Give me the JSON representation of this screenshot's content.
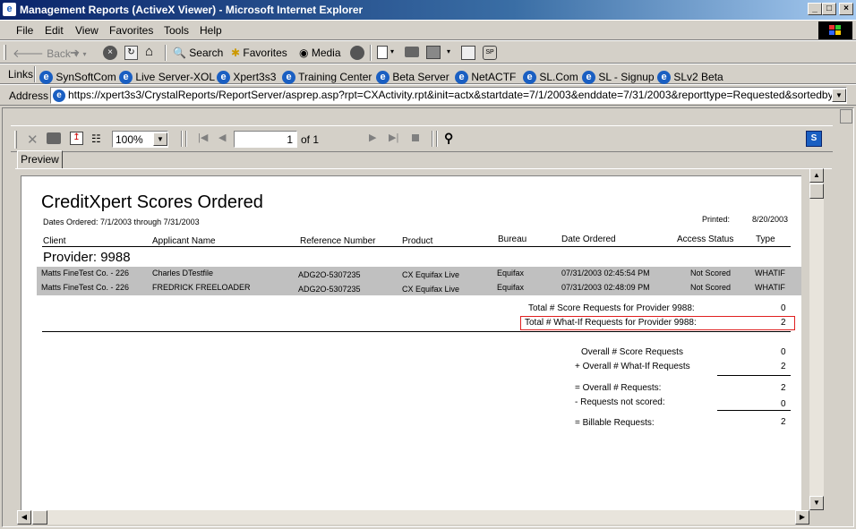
{
  "window": {
    "title": "Management Reports (ActiveX Viewer) - Microsoft Internet Explorer",
    "minimize": "_",
    "maximize": "□",
    "close": "×"
  },
  "menu": [
    "File",
    "Edit",
    "View",
    "Favorites",
    "Tools",
    "Help"
  ],
  "toolbar": {
    "back": "Back",
    "search": "Search",
    "favorites": "Favorites",
    "media": "Media"
  },
  "links": {
    "label": "Links",
    "items": [
      "SynSoftCom",
      "Live Server-XOL",
      "Xpert3s3",
      "Training Center",
      "Beta Server",
      "NetACTF",
      "SL.Com",
      "SL - Signup",
      "SLv2 Beta"
    ]
  },
  "address": {
    "label": "Address",
    "url": "https://xpert3s3/CrystalReports/ReportServer/asprep.asp?rpt=CXActivity.rpt&init=actx&startdate=7/1/2003&enddate=7/31/2003&reporttype=Requested&sortedby=Date"
  },
  "viewer": {
    "zoom": "100%",
    "page_value": "1",
    "page_of": "of 1",
    "tab": "Preview"
  },
  "report": {
    "title": "CreditXpert Scores Ordered",
    "dates": "Dates Ordered: 7/1/2003 through 7/31/2003",
    "printed_label": "Printed:",
    "printed_value": "8/20/2003",
    "columns": [
      "Client",
      "Applicant Name",
      "Reference Number",
      "Product",
      "Bureau",
      "Date Ordered",
      "Access Status",
      "Type"
    ],
    "provider": "Provider:  9988",
    "rows": [
      [
        "Matts FineTest Co. - 226",
        "Charles DTestfile",
        "ADG2O-5307235",
        "CX Equifax Live",
        "Equifax",
        "07/31/2003 02:45:54 PM",
        "Not Scored",
        "WHATIF"
      ],
      [
        "Matts FineTest Co. - 226",
        "FREDRICK FREELOADER",
        "ADG2O-5307235",
        "CX Equifax Live",
        "Equifax",
        "07/31/2003 02:48:09 PM",
        "Not Scored",
        "WHATIF"
      ]
    ],
    "provider_totals": [
      {
        "label": "Total # Score Requests for Provider 9988:",
        "value": "0"
      },
      {
        "label": "Total # What-If Requests for Provider 9988:",
        "value": "2"
      }
    ],
    "overall": [
      {
        "label": "Overall # Score Requests",
        "value": "0"
      },
      {
        "label": "+ Overall # What-If Requests",
        "value": "2"
      },
      {
        "label": "= Overall # Requests:",
        "value": "2"
      },
      {
        "label": "-  Requests not scored:",
        "value": "0"
      },
      {
        "label": "= Billable Requests:",
        "value": "2"
      }
    ]
  }
}
